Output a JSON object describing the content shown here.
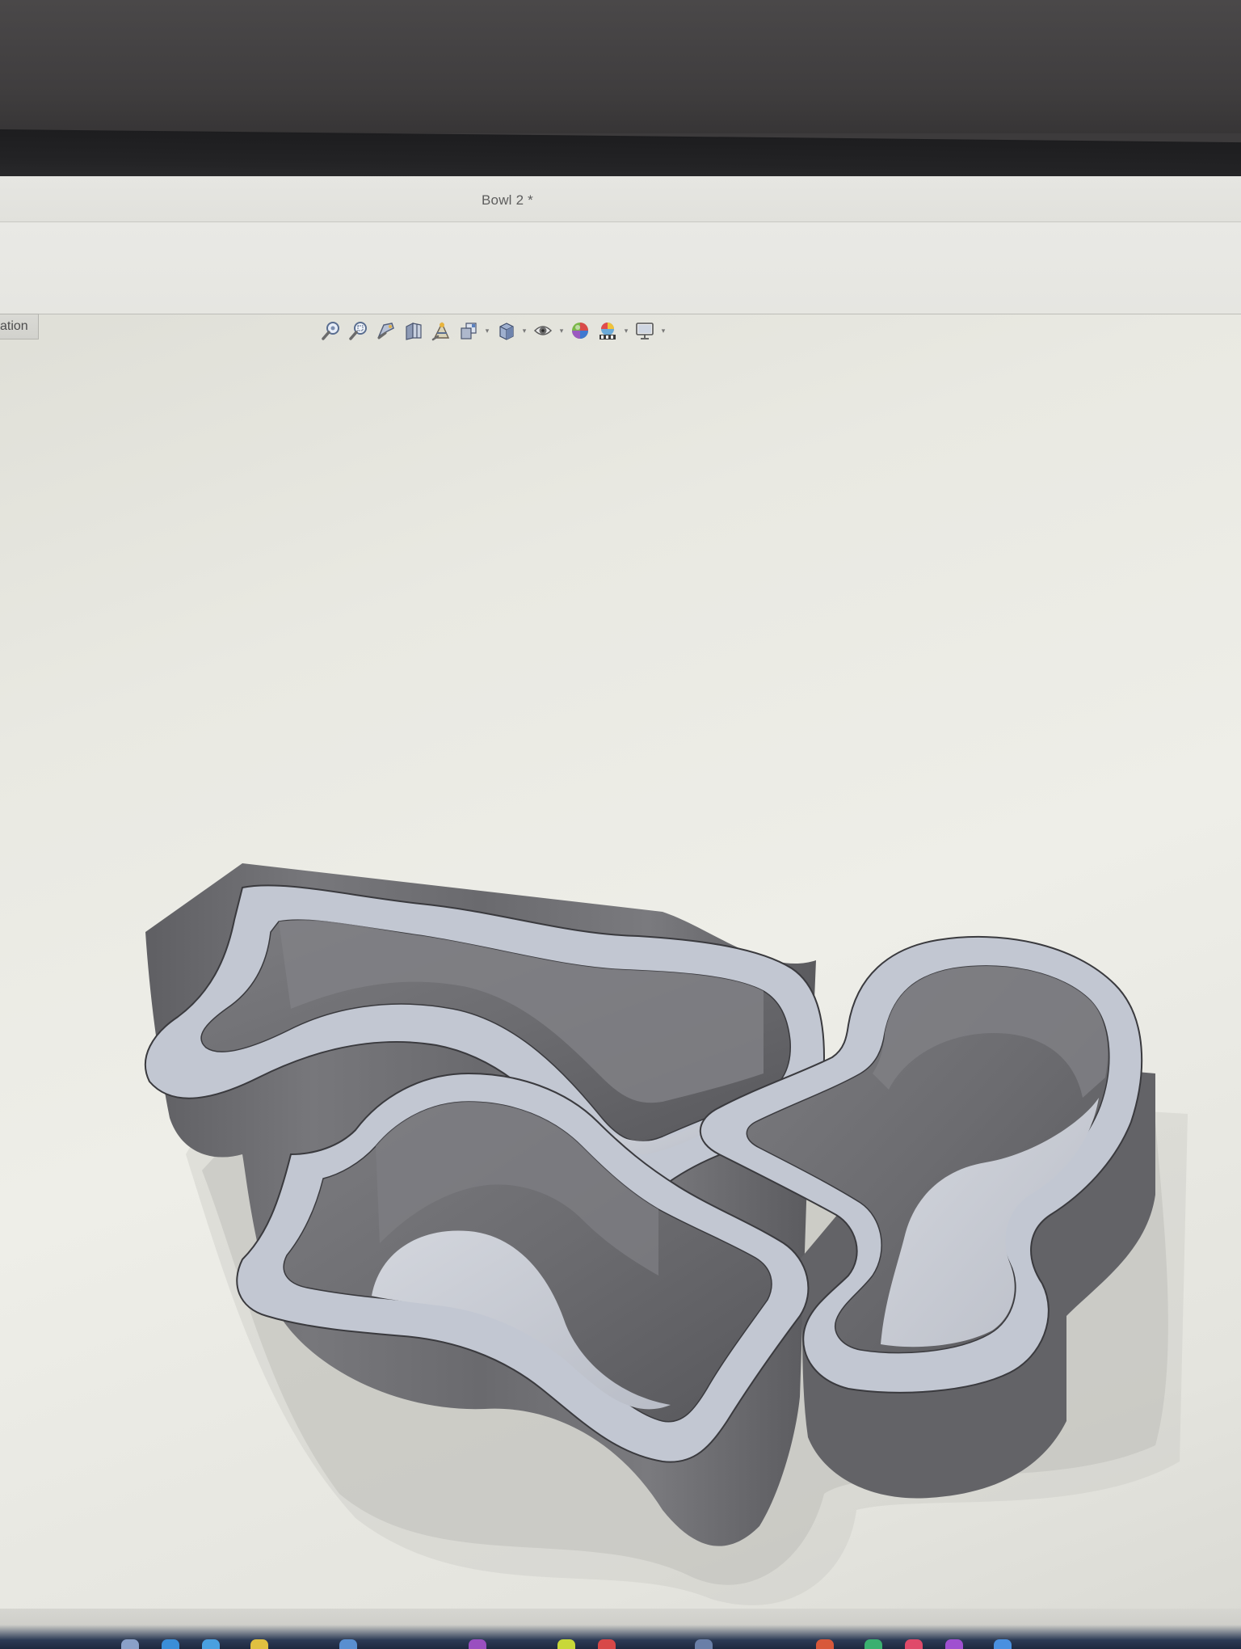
{
  "window": {
    "title": "Bowl 2 *"
  },
  "panel_tab": {
    "label": "ation"
  },
  "heads_up_toolbar": {
    "tools": [
      {
        "name": "zoom-to-fit",
        "icon": "zoom-fit-icon"
      },
      {
        "name": "zoom-to-area",
        "icon": "zoom-area-icon"
      },
      {
        "name": "previous-view",
        "icon": "previous-view-icon"
      },
      {
        "name": "section-view",
        "icon": "section-view-icon"
      },
      {
        "name": "dynamic-annotation",
        "icon": "annotation-icon"
      },
      {
        "name": "view-orientation",
        "icon": "view-orientation-icon"
      },
      {
        "name": "display-style",
        "icon": "display-style-icon"
      },
      {
        "name": "hide-show-items",
        "icon": "eye-icon"
      },
      {
        "name": "edit-appearance",
        "icon": "appearance-icon"
      },
      {
        "name": "apply-scene",
        "icon": "scene-icon"
      },
      {
        "name": "view-settings",
        "icon": "monitor-icon"
      }
    ]
  },
  "model": {
    "type": "wavy-bowl-solid",
    "face_color": "#c3c8d3",
    "wall_color": "#6e6e72"
  },
  "colors": {
    "background": "#e9e9e3",
    "bezel": "#1f1f21",
    "taskbar": "#1e2940"
  }
}
